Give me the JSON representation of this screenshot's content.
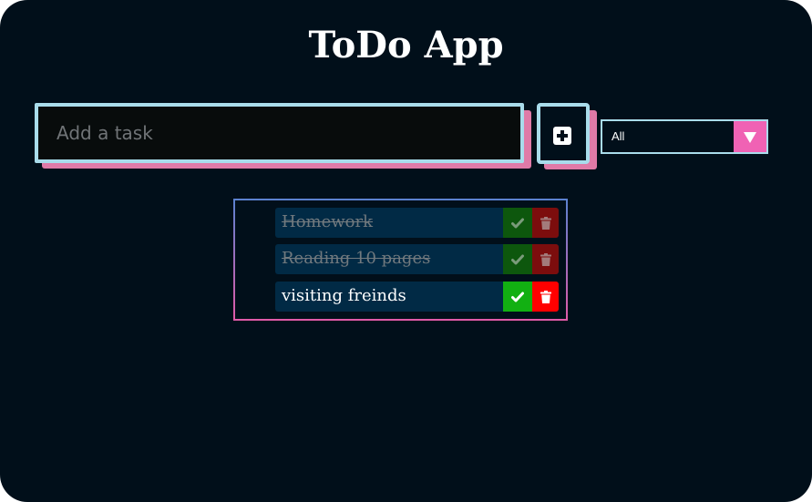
{
  "app": {
    "title": "ToDo App"
  },
  "input": {
    "placeholder": "Add a task",
    "value": ""
  },
  "add_button": {
    "icon": "plus-square-icon"
  },
  "filter": {
    "selected": "All"
  },
  "tasks": [
    {
      "text": "Homework",
      "completed": true
    },
    {
      "text": "Reading 10 pages",
      "completed": true
    },
    {
      "text": "visiting freinds",
      "completed": false
    }
  ],
  "colors": {
    "background": "#010f1a",
    "accent_blue": "#a9dceb",
    "accent_pink": "#f062b4",
    "task_bg": "#012a45",
    "check_green": "#12b012",
    "trash_red": "#ff0000"
  }
}
